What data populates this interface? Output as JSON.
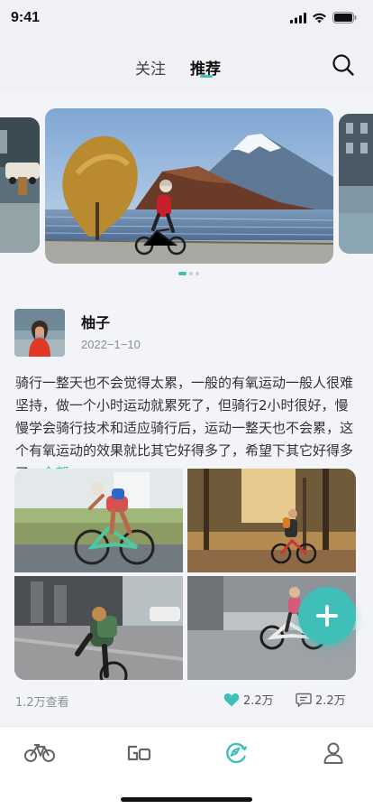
{
  "status_bar": {
    "time": "9:41"
  },
  "top_nav": {
    "tabs": [
      {
        "label": "关注",
        "active": false
      },
      {
        "label": "推荐",
        "active": true
      }
    ],
    "search_icon": "search-icon"
  },
  "banner": {
    "slides": [
      "city-street-slide",
      "mount-fuji-cyclist-slide",
      "city-building-slide"
    ],
    "active_index": 0,
    "dot_count": 3
  },
  "post": {
    "author": "柚子",
    "date": "2022−1−10",
    "text": "骑行一整天也不会觉得太累，一般的有氧运动一般人很难坚持，做一个小时运动就累死了，但骑行2小时很好，慢慢学会骑行技术和适应骑行后，运动一整天也不会累，这个有氧运动的效果就比其它好得多了，希望下其它好得多了...",
    "more_label": "全部",
    "photos": [
      "cyclist-racing-photo",
      "forest-bike-photo",
      "city-backpack-cyclist-photo",
      "street-kid-bike-photo"
    ],
    "views": "1.2万查看",
    "likes": "2.2万",
    "comments": "2.2万"
  },
  "fab": {
    "icon": "plus-icon"
  },
  "tab_bar": {
    "items": [
      {
        "name": "ride",
        "icon": "bicycle-icon",
        "active": false
      },
      {
        "name": "go",
        "icon": "go-icon",
        "active": false
      },
      {
        "name": "discover",
        "icon": "discover-icon",
        "active": true
      },
      {
        "name": "profile",
        "icon": "person-icon",
        "active": false
      }
    ]
  },
  "colors": {
    "accent": "#3fbfb8",
    "background": "#f3f4f7",
    "text_muted": "#8c9096"
  }
}
